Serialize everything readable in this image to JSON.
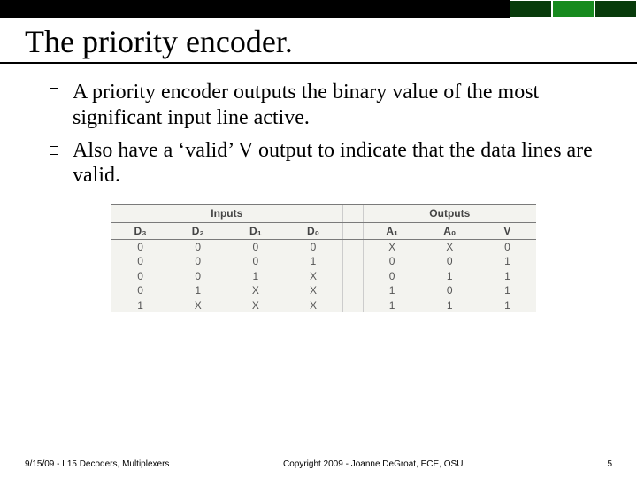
{
  "title": "The priority encoder.",
  "bullets": [
    "A priority encoder outputs the binary value of the most significant input line active.",
    "Also have a ‘valid’ V output to indicate that the data lines are valid."
  ],
  "chart_data": {
    "type": "table",
    "group_headers": {
      "inputs": "Inputs",
      "outputs": "Outputs"
    },
    "columns": {
      "inputs": [
        "D₃",
        "D₂",
        "D₁",
        "D₀"
      ],
      "outputs": [
        "A₁",
        "A₀",
        "V"
      ]
    },
    "rows": [
      {
        "inputs": [
          "0",
          "0",
          "0",
          "0"
        ],
        "outputs": [
          "X",
          "X",
          "0"
        ]
      },
      {
        "inputs": [
          "0",
          "0",
          "0",
          "1"
        ],
        "outputs": [
          "0",
          "0",
          "1"
        ]
      },
      {
        "inputs": [
          "0",
          "0",
          "1",
          "X"
        ],
        "outputs": [
          "0",
          "1",
          "1"
        ]
      },
      {
        "inputs": [
          "0",
          "1",
          "X",
          "X"
        ],
        "outputs": [
          "1",
          "0",
          "1"
        ]
      },
      {
        "inputs": [
          "1",
          "X",
          "X",
          "X"
        ],
        "outputs": [
          "1",
          "1",
          "1"
        ]
      }
    ]
  },
  "footer": {
    "left": "9/15/09 - L15 Decoders, Multiplexers",
    "center": "Copyright 2009 - Joanne DeGroat, ECE, OSU",
    "right": "5"
  }
}
